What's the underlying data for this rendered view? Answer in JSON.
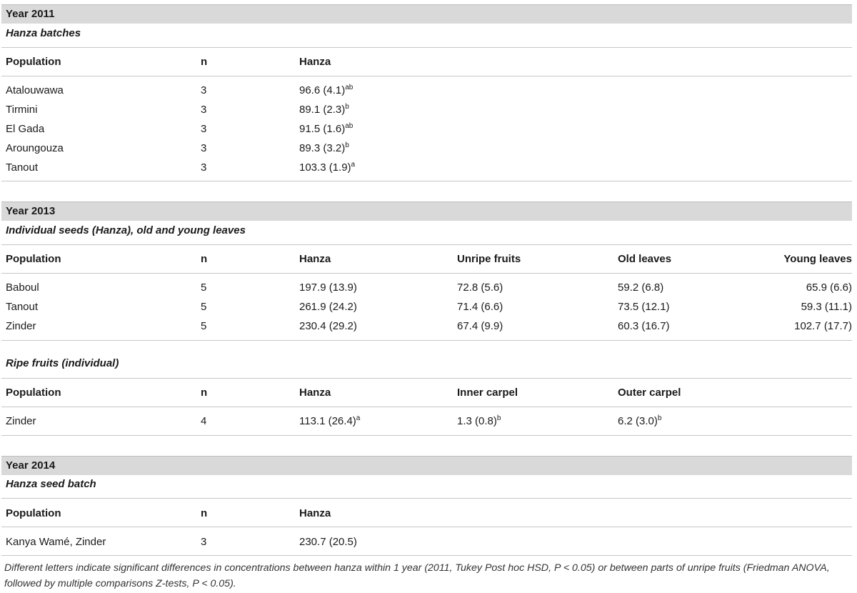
{
  "section_2011": {
    "year": "Year 2011",
    "subtitle": "Hanza batches",
    "headers": [
      "Population",
      "n",
      "Hanza"
    ],
    "rows": [
      {
        "population": "Atalouwawa",
        "n": "3",
        "hanza": "96.6 (4.1)",
        "hanza_sup": "ab"
      },
      {
        "population": "Tirmini",
        "n": "3",
        "hanza": "89.1 (2.3)",
        "hanza_sup": "b"
      },
      {
        "population": "El Gada",
        "n": "3",
        "hanza": "91.5 (1.6)",
        "hanza_sup": "ab"
      },
      {
        "population": "Aroungouza",
        "n": "3",
        "hanza": "89.3 (3.2)",
        "hanza_sup": "b"
      },
      {
        "population": "Tanout",
        "n": "3",
        "hanza": "103.3 (1.9)",
        "hanza_sup": "a"
      }
    ]
  },
  "section_2013": {
    "year": "Year 2013",
    "subtitle": "Individual seeds (Hanza), old and young leaves",
    "headers": [
      "Population",
      "n",
      "Hanza",
      "Unripe fruits",
      "Old leaves",
      "Young leaves"
    ],
    "rows": [
      {
        "population": "Baboul",
        "n": "5",
        "hanza": "197.9 (13.9)",
        "unripe": "72.8 (5.6)",
        "old": "59.2 (6.8)",
        "young": "65.9 (6.6)"
      },
      {
        "population": "Tanout",
        "n": "5",
        "hanza": "261.9 (24.2)",
        "unripe": "71.4 (6.6)",
        "old": "73.5 (12.1)",
        "young": "59.3 (11.1)"
      },
      {
        "population": "Zinder",
        "n": "5",
        "hanza": "230.4 (29.2)",
        "unripe": "67.4 (9.9)",
        "old": "60.3 (16.7)",
        "young": "102.7 (17.7)"
      }
    ],
    "ripe_subtitle": "Ripe fruits (individual)",
    "ripe_headers": [
      "Population",
      "n",
      "Hanza",
      "Inner carpel",
      "Outer carpel"
    ],
    "ripe_rows": [
      {
        "population": "Zinder",
        "n": "4",
        "hanza": "113.1 (26.4)",
        "hanza_sup": "a",
        "inner": "1.3 (0.8)",
        "inner_sup": "b",
        "outer": "6.2 (3.0)",
        "outer_sup": "b"
      }
    ]
  },
  "section_2014": {
    "year": "Year 2014",
    "subtitle": "Hanza seed batch",
    "headers": [
      "Population",
      "n",
      "Hanza"
    ],
    "rows": [
      {
        "population": "Kanya Wamé, Zinder",
        "n": "3",
        "hanza": "230.7 (20.5)"
      }
    ]
  },
  "footnote": "Different letters indicate significant differences in concentrations between hanza within 1 year (2011, Tukey Post hoc HSD, P < 0.05) or between parts of unripe fruits (Friedman ANOVA, followed by multiple comparisons Z-tests, P < 0.05)."
}
